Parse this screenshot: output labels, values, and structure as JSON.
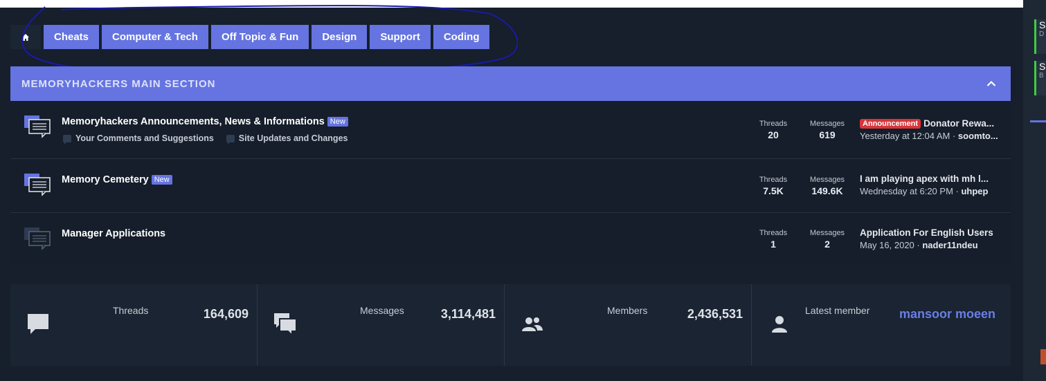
{
  "nav": {
    "tabs": [
      {
        "label": "Cheats"
      },
      {
        "label": "Computer & Tech"
      },
      {
        "label": "Off Topic & Fun"
      },
      {
        "label": "Design"
      },
      {
        "label": "Support"
      },
      {
        "label": "Coding"
      }
    ]
  },
  "section": {
    "title": "MEMORYHACKERS MAIN SECTION",
    "nodes": [
      {
        "title": "Memoryhackers Announcements, News & Informations",
        "badge": "New",
        "subforums": [
          "Your Comments and Suggestions",
          "Site Updates and Changes"
        ],
        "threads_label": "Threads",
        "threads": "20",
        "messages_label": "Messages",
        "messages": "619",
        "latest_prefix": "Announcement",
        "latest_title": "Donator Rewa...",
        "latest_time": "Yesterday at 12:04 AM",
        "latest_sep": " · ",
        "latest_user": "soomto..."
      },
      {
        "title": "Memory Cemetery",
        "badge": "New",
        "threads_label": "Threads",
        "threads": "7.5K",
        "messages_label": "Messages",
        "messages": "149.6K",
        "latest_title": "I am playing apex with mh l...",
        "latest_time": "Wednesday at 6:20 PM",
        "latest_sep": " · ",
        "latest_user": "uhpep"
      },
      {
        "title": "Manager Applications",
        "threads_label": "Threads",
        "threads": "1",
        "messages_label": "Messages",
        "messages": "2",
        "latest_title": "Application For English Users",
        "latest_time": "May 16, 2020",
        "latest_sep": " · ",
        "latest_user": "nader11ndeu"
      }
    ]
  },
  "stats": {
    "threads_label": "Threads",
    "threads": "164,609",
    "messages_label": "Messages",
    "messages": "3,114,481",
    "members_label": "Members",
    "members": "2,436,531",
    "latest_member_label": "Latest member",
    "latest_member": "mansoor moeen"
  },
  "right_panel": {
    "cards": [
      {
        "letter": "S",
        "sub": "D"
      },
      {
        "letter": "S",
        "sub": "B"
      }
    ]
  },
  "colors": {
    "accent": "#6574e0",
    "background": "#161f2b",
    "announcement": "#d9353b",
    "annotation_stroke": "#1a1aa8"
  }
}
